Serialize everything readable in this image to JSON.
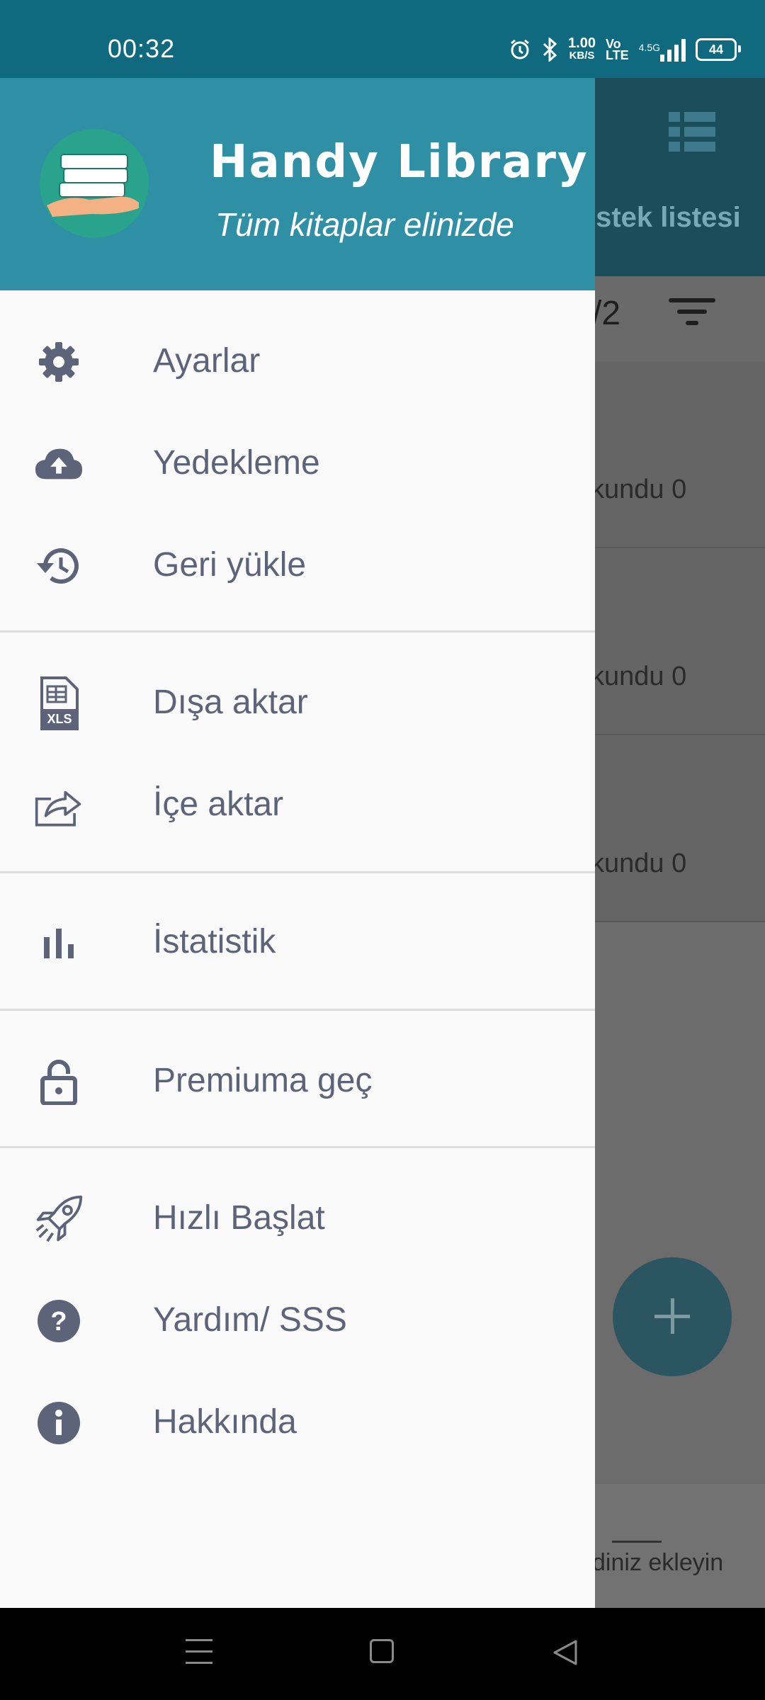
{
  "status_bar": {
    "time": "00:32",
    "network_speed_value": "1.00",
    "network_speed_unit": "KB/S",
    "volte_top": "Vo",
    "volte_bottom": "LTE",
    "signal_label": "4.5G",
    "battery": "44"
  },
  "background_app": {
    "tab_label": "İstek listesi",
    "page_count": "/2",
    "rows": [
      "kundu 0",
      "kundu 0",
      "kundu 0"
    ],
    "bottom_label": "diniz ekleyin"
  },
  "drawer": {
    "title": "Handy Library",
    "subtitle": "Tüm kitaplar elinizde",
    "items": [
      {
        "label": "Ayarlar",
        "icon": "gear-icon"
      },
      {
        "label": "Yedekleme",
        "icon": "cloud-upload-icon"
      },
      {
        "label": "Geri yükle",
        "icon": "history-icon"
      },
      {
        "label": "Dışa aktar",
        "icon": "xls-file-icon"
      },
      {
        "label": "İçe aktar",
        "icon": "import-share-icon"
      },
      {
        "label": "İstatistik",
        "icon": "bar-chart-icon"
      },
      {
        "label": "Premiuma geç",
        "icon": "lock-icon"
      },
      {
        "label": "Hızlı Başlat",
        "icon": "rocket-icon"
      },
      {
        "label": "Yardım/ SSS",
        "icon": "help-icon"
      },
      {
        "label": "Hakkında",
        "icon": "info-icon"
      }
    ]
  },
  "colors": {
    "status_bar": "#0f6a80",
    "drawer_header": "#2e8fa5",
    "menu_text": "#5d6479",
    "icon": "#5d6479"
  }
}
